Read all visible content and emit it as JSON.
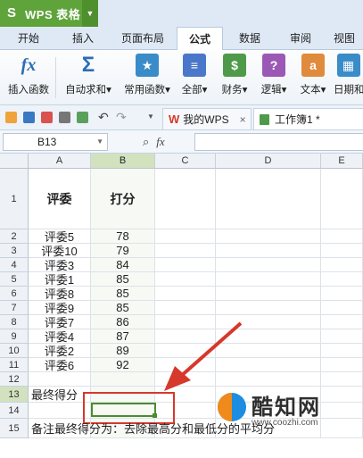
{
  "app": {
    "title": "WPS 表格",
    "logo": "S"
  },
  "tabs": [
    "开始",
    "插入",
    "页面布局",
    "公式",
    "数据",
    "审阅",
    "视图"
  ],
  "active_tab": "公式",
  "ribbon": [
    {
      "label": "插入函数",
      "icon": "fx-icon",
      "glyph": "fx"
    },
    {
      "label": "自动求和▾",
      "icon": "sigma-icon",
      "glyph": "Σ"
    },
    {
      "label": "常用函数▾",
      "icon": "star-icon",
      "glyph": "★"
    },
    {
      "label": "全部▾",
      "icon": "book-icon",
      "glyph": "≡"
    },
    {
      "label": "财务▾",
      "icon": "finance-icon",
      "glyph": "$"
    },
    {
      "label": "逻辑▾",
      "icon": "logic-icon",
      "glyph": "?"
    },
    {
      "label": "文本▾",
      "icon": "text-icon",
      "glyph": "a"
    },
    {
      "label": "日期和",
      "icon": "date-icon",
      "glyph": "▦"
    }
  ],
  "doc_tabs": [
    {
      "label": "我的WPS",
      "close": "×"
    },
    {
      "label": "工作簿1 *"
    }
  ],
  "formula_bar": {
    "cell_ref": "B13",
    "fx": "fx",
    "value": ""
  },
  "columns": [
    "A",
    "B",
    "C",
    "D",
    "E"
  ],
  "rows": [
    "1",
    "2",
    "3",
    "4",
    "5",
    "6",
    "7",
    "8",
    "9",
    "10",
    "11",
    "12",
    "13",
    "14",
    "15"
  ],
  "table": {
    "header_a": "评委",
    "header_b": "打分",
    "entries": [
      {
        "judge": "评委5",
        "score": "78"
      },
      {
        "judge": "评委10",
        "score": "79"
      },
      {
        "judge": "评委3",
        "score": "84"
      },
      {
        "judge": "评委1",
        "score": "85"
      },
      {
        "judge": "评委8",
        "score": "85"
      },
      {
        "judge": "评委9",
        "score": "85"
      },
      {
        "judge": "评委7",
        "score": "86"
      },
      {
        "judge": "评委4",
        "score": "87"
      },
      {
        "judge": "评委2",
        "score": "89"
      },
      {
        "judge": "评委6",
        "score": "92"
      }
    ],
    "final_label": "最终得分",
    "note": "备注最终得分为：去除最高分和最低分的平均分"
  },
  "selected_cell": "B13",
  "colors": {
    "accent": "#5fa43a",
    "annotation": "#d6382b"
  },
  "watermark": {
    "name": "酷知网",
    "url": "www.coozhi.com"
  }
}
